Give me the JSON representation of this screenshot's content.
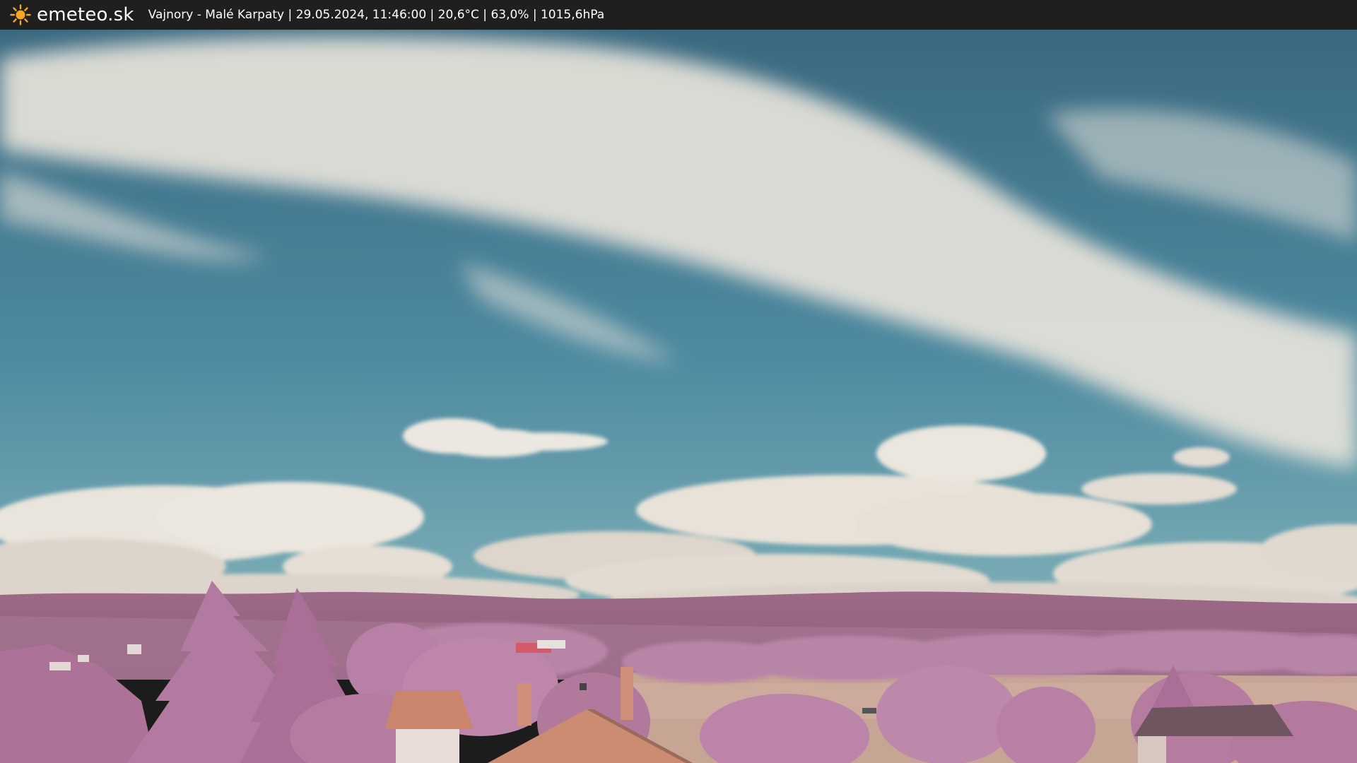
{
  "header": {
    "logo_icon": "sun-icon",
    "brand": "emeteo.sk",
    "caption": "Vajnory - Malé Karpaty | 29.05.2024, 11:46:00 | 20,6°C | 63,0% | 1015,6hPa"
  },
  "colors": {
    "bar": "#1f1f1f",
    "sun": "#f5a623",
    "sky_top": "#3f6f86",
    "sky_bottom": "#5a93a6",
    "cloud": "#e9e4dc",
    "hills": "#a8768f",
    "trees": "#b37aa0",
    "field": "#c9a89a",
    "roof": "#c9866c"
  }
}
